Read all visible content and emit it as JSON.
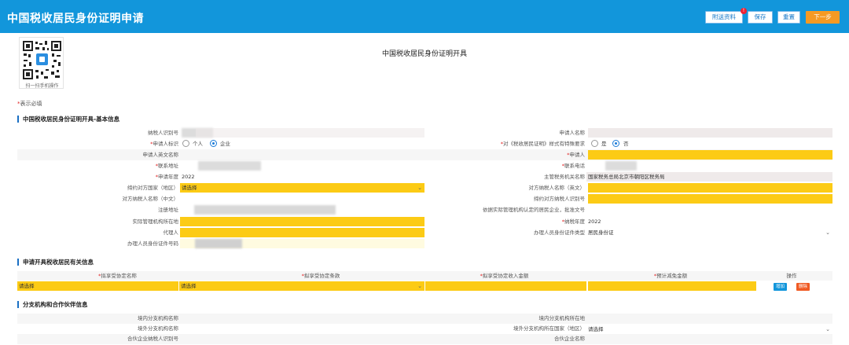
{
  "header": {
    "title": "中国税收居民身份证明申请",
    "buttons": {
      "attach": "附送资料",
      "attach_badge": "!",
      "save": "保存",
      "reset": "重置",
      "next": "下一步"
    },
    "colors": {
      "bar": "#1296db",
      "accent": "#f59a23"
    }
  },
  "qr": {
    "caption": "扫一扫手机操作"
  },
  "page_heading": "中国税收居民身份证明开具",
  "required_note": {
    "star": "*",
    "text": "表示必填"
  },
  "section1": {
    "title": "中国税收居民身份证明开具-基本信息",
    "fields": {
      "taxpayer_id": "纳税人识别号",
      "applicant_name": "申请人名称",
      "applicant_type": "申请人标识",
      "type_personal": "个人",
      "type_company": "企业",
      "special_req": "对《税收居民证明》样式有特殊要求",
      "yes": "是",
      "no": "否",
      "english_name": "申请人英文名称",
      "applicant": "申请人",
      "contact_addr": "联系地址",
      "contact_phone": "联系电话",
      "apply_year": "申请年度",
      "apply_year_value": "2022",
      "tax_authority": "主管税务机关名称",
      "tax_authority_value": "国家税务总局北京市朝阳区税务局",
      "treaty_country": "缔约对方国家（地区）",
      "treaty_country_value": "请选择",
      "cp_name_en": "对方纳税人名称（英文）",
      "cp_name_cn": "对方纳税人名称（中文）",
      "cp_taxpayer_id": "缔约对方纳税人识别号",
      "reg_addr": "注册地址",
      "resident_basis": "依据实际管理机构认定的居民企业，批准文号",
      "mgmt_location": "实际管理机构所在地",
      "tax_year": "纳税年度",
      "tax_year_value": "2022",
      "agent": "代理人",
      "handler_doc_type": "办理人员身份证件类型",
      "handler_doc_type_value": "居民身份证",
      "handler_doc_no": "办理人员身份证件号码"
    }
  },
  "section2": {
    "title": "申请开具税收居民有关信息",
    "headers": {
      "treaty_name": "拟享受协定名称",
      "treaty_article": "拟享受协定条款",
      "income_amount": "拟享受协定收入金额",
      "exempt_amount": "预计减免金额",
      "ops": "操作"
    },
    "row": {
      "treaty_name": "请选择",
      "treaty_article": "请选择"
    },
    "actions": {
      "add": "增加",
      "delete": "删除"
    }
  },
  "section3": {
    "title": "分支机构和合作伙伴信息",
    "fields": {
      "dom_branch_name": "境内分支机构名称",
      "dom_branch_loc": "境内分支机构所在地",
      "for_branch_name": "境外分支机构名称",
      "for_branch_country": "境外分支机构所在国家（地区）",
      "for_branch_country_value": "请选择",
      "partner_id": "合伙企业纳税人识别号",
      "partner_name": "合伙企业名称"
    }
  }
}
